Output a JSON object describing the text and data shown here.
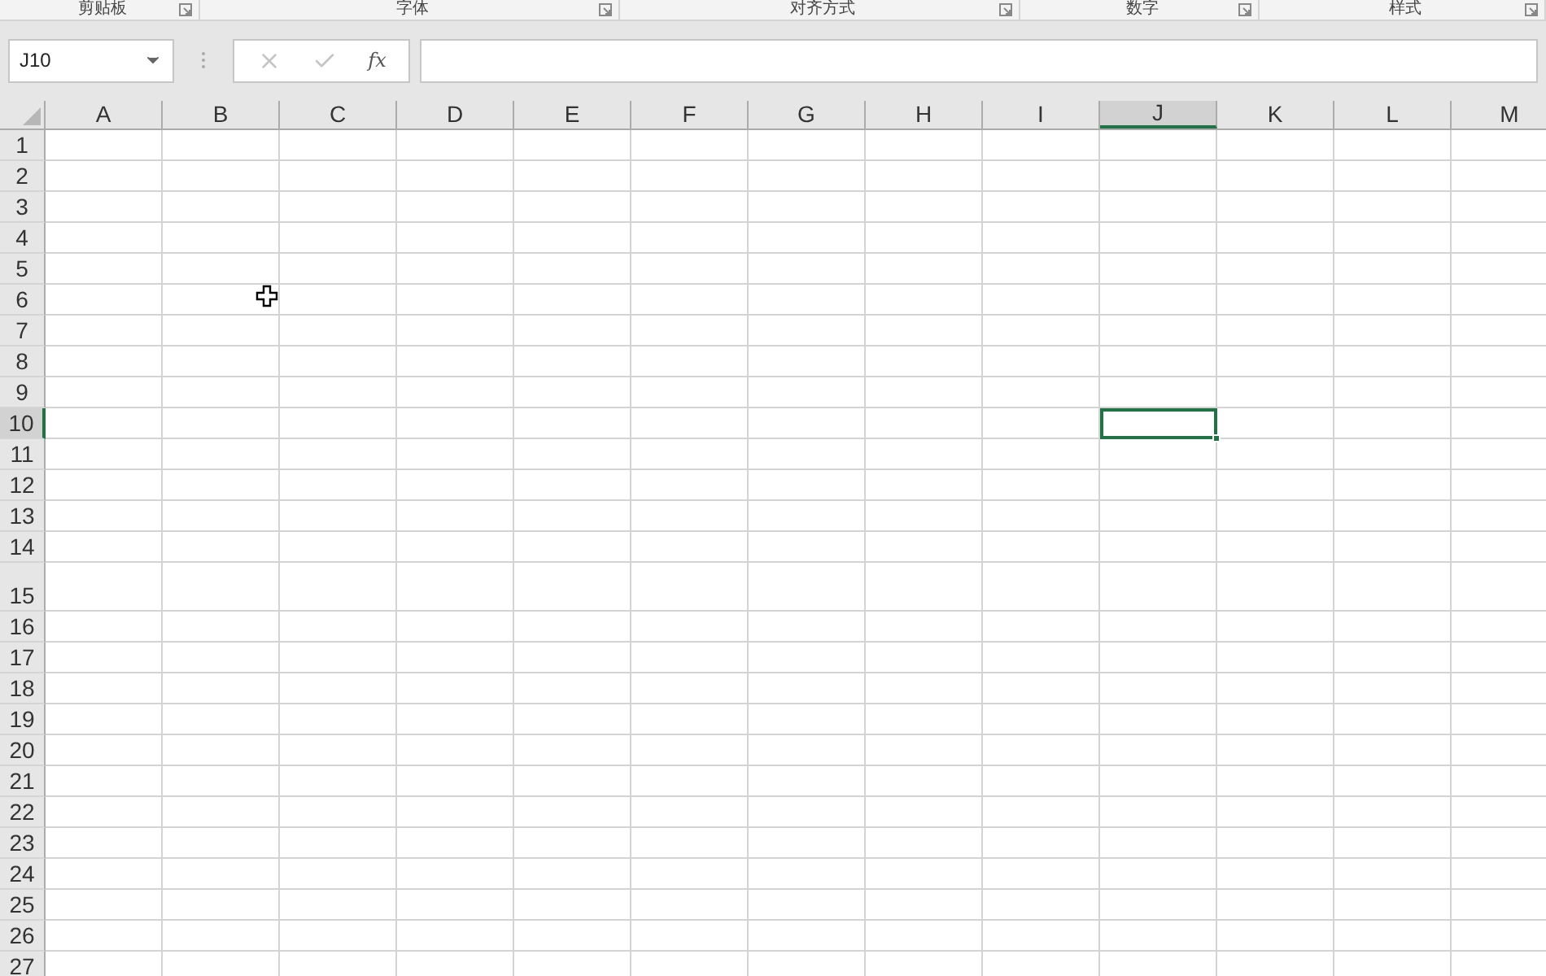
{
  "ribbon_groups": [
    {
      "label": "剪贴板"
    },
    {
      "label": "字体"
    },
    {
      "label": "对齐方式"
    },
    {
      "label": "数字"
    },
    {
      "label": "样式"
    }
  ],
  "name_box": {
    "value": "J10"
  },
  "formula_bar": {
    "fx_label": "fx"
  },
  "columns": [
    {
      "label": "A",
      "selected": false
    },
    {
      "label": "B",
      "selected": false
    },
    {
      "label": "C",
      "selected": false
    },
    {
      "label": "D",
      "selected": false
    },
    {
      "label": "E",
      "selected": false
    },
    {
      "label": "F",
      "selected": false
    },
    {
      "label": "G",
      "selected": false
    },
    {
      "label": "H",
      "selected": false
    },
    {
      "label": "I",
      "selected": false
    },
    {
      "label": "J",
      "selected": true
    },
    {
      "label": "K",
      "selected": false
    },
    {
      "label": "L",
      "selected": false
    },
    {
      "label": "M",
      "selected": false
    }
  ],
  "rows": [
    {
      "label": "1",
      "selected": false,
      "kind": "normal"
    },
    {
      "label": "2",
      "selected": false,
      "kind": "normal"
    },
    {
      "label": "3",
      "selected": false,
      "kind": "normal"
    },
    {
      "label": "4",
      "selected": false,
      "kind": "normal"
    },
    {
      "label": "5",
      "selected": false,
      "kind": "normal"
    },
    {
      "label": "6",
      "selected": false,
      "kind": "normal"
    },
    {
      "label": "7",
      "selected": false,
      "kind": "normal"
    },
    {
      "label": "8",
      "selected": false,
      "kind": "normal"
    },
    {
      "label": "9",
      "selected": false,
      "kind": "normal"
    },
    {
      "label": "10",
      "selected": true,
      "kind": "normal"
    },
    {
      "label": "11",
      "selected": false,
      "kind": "normal"
    },
    {
      "label": "12",
      "selected": false,
      "kind": "normal"
    },
    {
      "label": "13",
      "selected": false,
      "kind": "normal"
    },
    {
      "label": "14",
      "selected": false,
      "kind": "normal"
    },
    {
      "label": "15",
      "selected": false,
      "kind": "tall"
    },
    {
      "label": "16",
      "selected": false,
      "kind": "normal"
    },
    {
      "label": "17",
      "selected": false,
      "kind": "normal"
    },
    {
      "label": "18",
      "selected": false,
      "kind": "normal"
    },
    {
      "label": "19",
      "selected": false,
      "kind": "normal"
    },
    {
      "label": "20",
      "selected": false,
      "kind": "normal"
    },
    {
      "label": "21",
      "selected": false,
      "kind": "normal"
    },
    {
      "label": "22",
      "selected": false,
      "kind": "normal"
    },
    {
      "label": "23",
      "selected": false,
      "kind": "normal"
    },
    {
      "label": "24",
      "selected": false,
      "kind": "normal"
    },
    {
      "label": "25",
      "selected": false,
      "kind": "normal"
    },
    {
      "label": "26",
      "selected": false,
      "kind": "normal"
    },
    {
      "label": "27",
      "selected": false,
      "kind": "normal"
    }
  ]
}
